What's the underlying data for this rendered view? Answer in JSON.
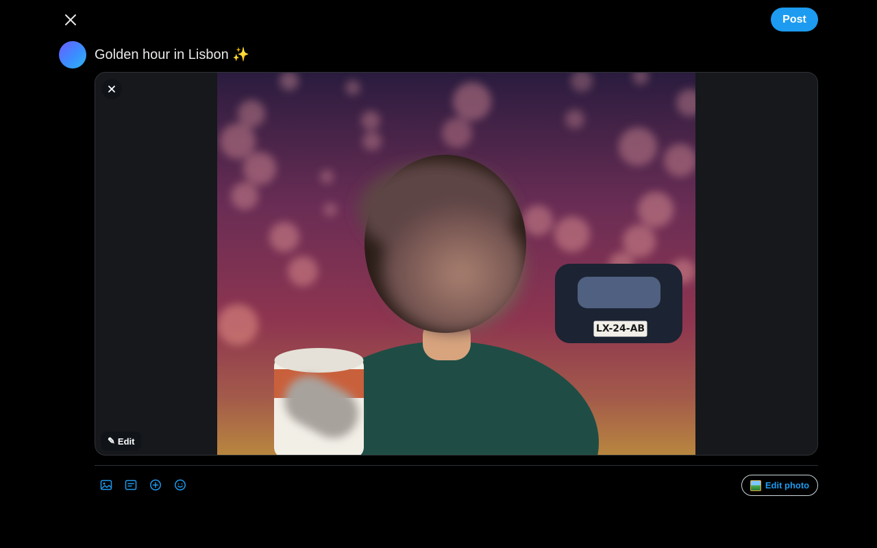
{
  "composer": {
    "post_label": "Post",
    "text": "Golden hour in Lisbon ✨"
  },
  "media": {
    "edit_label": "Edit",
    "plate_text": "LX-24-AB"
  },
  "toolbar": {
    "edit_photo_label": "Edit photo",
    "icons": [
      "image-icon",
      "gif-icon",
      "add-icon",
      "emoji-icon"
    ]
  },
  "colors": {
    "accent": "#1d9bf0",
    "background": "#000000",
    "border": "#2f3336"
  }
}
